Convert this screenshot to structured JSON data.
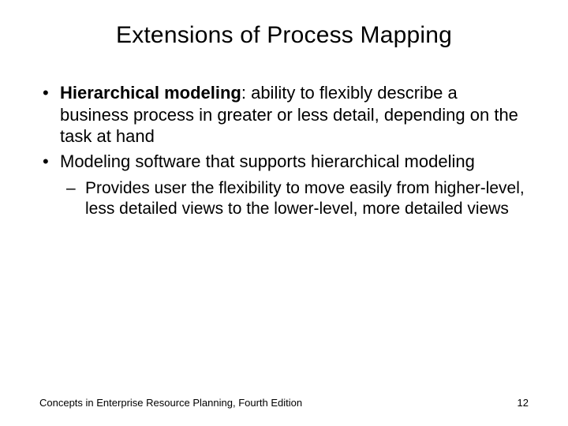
{
  "title": "Extensions of Process Mapping",
  "bullets": {
    "b1_label": "Hierarchical modeling",
    "b1_rest": ": ability to flexibly describe a business process in greater or less detail, depending on the task at hand",
    "b2": "Modeling software that supports hierarchical modeling",
    "b2_sub1": "Provides user the flexibility to move easily from higher-level, less detailed views to the lower-level, more detailed views"
  },
  "footer": {
    "text": "Concepts in Enterprise Resource Planning, Fourth Edition",
    "page": "12"
  }
}
